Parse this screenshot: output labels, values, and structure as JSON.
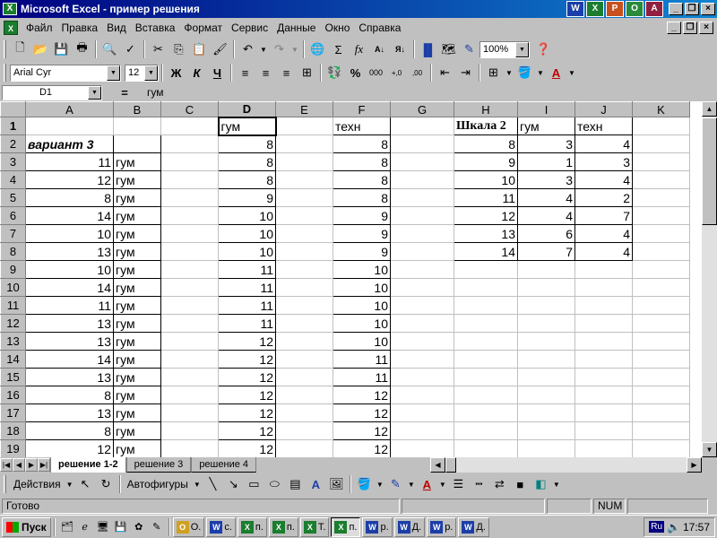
{
  "window": {
    "title": "Microsoft Excel - пример решения",
    "office_icons": [
      "W",
      "X",
      "P",
      "O",
      "A"
    ]
  },
  "menu": [
    "Файл",
    "Правка",
    "Вид",
    "Вставка",
    "Формат",
    "Сервис",
    "Данные",
    "Окно",
    "Справка"
  ],
  "toolbar": {
    "zoom": "100%",
    "font_name": "Arial Cyr",
    "font_size": "12",
    "bold": "Ж",
    "italic": "К",
    "underline": "Ч",
    "percent": "%",
    "thousands": "000",
    "dec_inc": "+,0",
    "dec_dec": ",00"
  },
  "formula_bar": {
    "name_box": "D1",
    "eq": "=",
    "value": "гум"
  },
  "columns": [
    "A",
    "B",
    "C",
    "D",
    "E",
    "F",
    "G",
    "H",
    "I",
    "J",
    "K"
  ],
  "rows": [
    [
      "",
      "",
      "",
      "гум",
      "",
      "техн",
      "",
      "Шкала 2",
      "гум",
      "техн",
      ""
    ],
    [
      "вариант 3",
      "",
      "",
      "8",
      "",
      "8",
      "",
      "8",
      "3",
      "4",
      ""
    ],
    [
      "11",
      "гум",
      "",
      "8",
      "",
      "8",
      "",
      "9",
      "1",
      "3",
      ""
    ],
    [
      "12",
      "гум",
      "",
      "8",
      "",
      "8",
      "",
      "10",
      "3",
      "4",
      ""
    ],
    [
      "8",
      "гум",
      "",
      "9",
      "",
      "8",
      "",
      "11",
      "4",
      "2",
      ""
    ],
    [
      "14",
      "гум",
      "",
      "10",
      "",
      "9",
      "",
      "12",
      "4",
      "7",
      ""
    ],
    [
      "10",
      "гум",
      "",
      "10",
      "",
      "9",
      "",
      "13",
      "6",
      "4",
      ""
    ],
    [
      "13",
      "гум",
      "",
      "10",
      "",
      "9",
      "",
      "14",
      "7",
      "4",
      ""
    ],
    [
      "10",
      "гум",
      "",
      "11",
      "",
      "10",
      "",
      "",
      "",
      "",
      ""
    ],
    [
      "14",
      "гум",
      "",
      "11",
      "",
      "10",
      "",
      "",
      "",
      "",
      ""
    ],
    [
      "11",
      "гум",
      "",
      "11",
      "",
      "10",
      "",
      "",
      "",
      "",
      ""
    ],
    [
      "13",
      "гум",
      "",
      "11",
      "",
      "10",
      "",
      "",
      "",
      "",
      ""
    ],
    [
      "13",
      "гум",
      "",
      "12",
      "",
      "10",
      "",
      "",
      "",
      "",
      ""
    ],
    [
      "14",
      "гум",
      "",
      "12",
      "",
      "11",
      "",
      "",
      "",
      "",
      ""
    ],
    [
      "13",
      "гум",
      "",
      "12",
      "",
      "11",
      "",
      "",
      "",
      "",
      ""
    ],
    [
      "8",
      "гум",
      "",
      "12",
      "",
      "12",
      "",
      "",
      "",
      "",
      ""
    ],
    [
      "13",
      "гум",
      "",
      "12",
      "",
      "12",
      "",
      "",
      "",
      "",
      ""
    ],
    [
      "8",
      "гум",
      "",
      "12",
      "",
      "12",
      "",
      "",
      "",
      "",
      ""
    ],
    [
      "12",
      "гум",
      "",
      "12",
      "",
      "12",
      "",
      "",
      "",
      "",
      ""
    ]
  ],
  "sheet_tabs": [
    "решение 1-2",
    "решение 3",
    "решение 4"
  ],
  "draw_toolbar": {
    "actions": "Действия",
    "autoshapes": "Автофигуры"
  },
  "status": {
    "ready": "Готово",
    "num": "NUM"
  },
  "taskbar": {
    "start": "Пуск",
    "tasks": [
      {
        "icon": "O",
        "label": "О.",
        "kind": "o"
      },
      {
        "icon": "W",
        "label": "с.",
        "kind": "w"
      },
      {
        "icon": "X",
        "label": "п.",
        "kind": "x"
      },
      {
        "icon": "X",
        "label": "п.",
        "kind": "x"
      },
      {
        "icon": "X",
        "label": "Т.",
        "kind": "x"
      },
      {
        "icon": "X",
        "label": "п.",
        "kind": "x",
        "active": true
      },
      {
        "icon": "W",
        "label": "р.",
        "kind": "w"
      },
      {
        "icon": "W",
        "label": "Д.",
        "kind": "w"
      },
      {
        "icon": "W",
        "label": "р.",
        "kind": "w"
      },
      {
        "icon": "W",
        "label": "Д.",
        "kind": "w"
      }
    ],
    "lang": "Ru",
    "clock": "17:57"
  }
}
